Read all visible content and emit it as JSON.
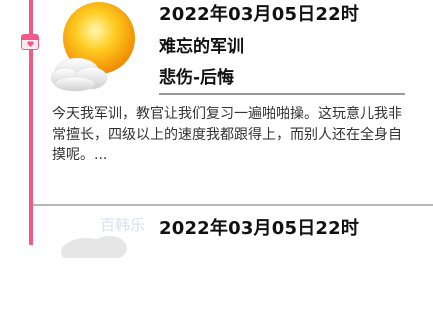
{
  "entries": [
    {
      "date": "2022年03月05日22时",
      "title": "难忘的军训",
      "mood": "悲伤-后悔",
      "weather_icon": "sun-cloud-icon",
      "content": "今天我军训，教官让我们复习一遍啪啪操。这玩意儿我非常擅长，四级以上的速度我都跟得上，而别人还在全身自摸呢。..."
    },
    {
      "date": "2022年03月05日22时",
      "weather_icon": "cloud-icon"
    }
  ],
  "watermark": "百韩乐",
  "colors": {
    "timeline": "#ef5b86",
    "divider": "#9a9a9a",
    "text": "#333333"
  }
}
